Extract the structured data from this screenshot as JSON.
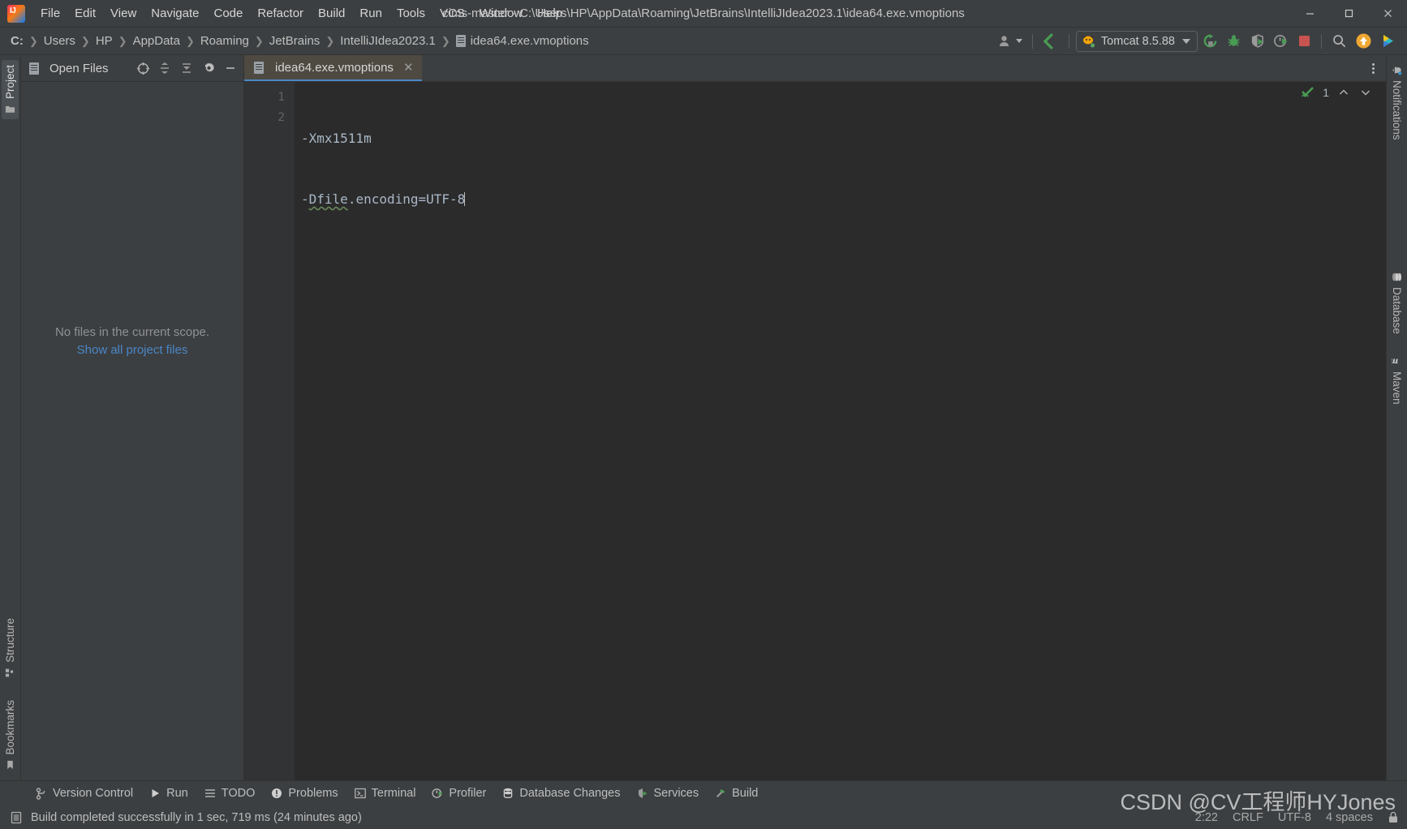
{
  "window": {
    "title": "cims-master - C:\\Users\\HP\\AppData\\Roaming\\JetBrains\\IntelliJIdea2023.1\\idea64.exe.vmoptions",
    "minimize_label": "—",
    "maximize_label": "☐",
    "close_label": "✕"
  },
  "menu": [
    {
      "label": "File"
    },
    {
      "label": "Edit"
    },
    {
      "label": "View"
    },
    {
      "label": "Navigate"
    },
    {
      "label": "Code"
    },
    {
      "label": "Refactor"
    },
    {
      "label": "Build"
    },
    {
      "label": "Run"
    },
    {
      "label": "Tools"
    },
    {
      "label": "VCS"
    },
    {
      "label": "Window"
    },
    {
      "label": "Help"
    }
  ],
  "breadcrumbs": [
    {
      "label": "C:"
    },
    {
      "label": "Users"
    },
    {
      "label": "HP"
    },
    {
      "label": "AppData"
    },
    {
      "label": "Roaming"
    },
    {
      "label": "JetBrains"
    },
    {
      "label": "IntelliJIdea2023.1"
    },
    {
      "label": "idea64.exe.vmoptions"
    }
  ],
  "toolbar": {
    "account_icon": "user-account-icon",
    "updates_icon": "green-arrow-icon",
    "run_config": "Tomcat 8.5.88",
    "run_icon": "run-icon",
    "debug_icon": "debug-bug-icon",
    "coverage_icon": "run-with-coverage-icon",
    "profiler_icon": "profiler-icon",
    "stop_icon": "stop-icon",
    "search_icon": "search-icon",
    "update_badge_icon": "update-available-icon",
    "ide_feature_icon": "ide-feature-icon"
  },
  "left_stripe": {
    "top": [
      {
        "label": "Project",
        "icon": "project-folder-icon"
      }
    ],
    "bottom": [
      {
        "label": "Structure",
        "icon": "structure-icon"
      },
      {
        "label": "Bookmarks",
        "icon": "bookmark-icon"
      }
    ]
  },
  "right_stripe": [
    {
      "label": "Notifications",
      "icon": "bell-icon"
    },
    {
      "label": "Database",
      "icon": "database-icon"
    },
    {
      "label": "Maven",
      "icon": "maven-m-icon"
    }
  ],
  "project_panel": {
    "title": "Open Files",
    "icon": "file-icon",
    "actions": [
      {
        "name": "scope-target-icon",
        "glyph": "⊕"
      },
      {
        "name": "expand-all-icon",
        "glyph": "⇕"
      },
      {
        "name": "collapse-all-icon",
        "glyph": "⇡"
      },
      {
        "name": "settings-gear-icon",
        "glyph": "⚙"
      },
      {
        "name": "hide-panel-icon",
        "glyph": "—"
      }
    ],
    "empty_message": "No files in the current scope.",
    "empty_link": "Show all project files"
  },
  "editor": {
    "tab_label": "idea64.exe.vmoptions",
    "tab_close": "✕",
    "lines": [
      {
        "number": "1",
        "text": "-Xmx1511m"
      },
      {
        "number": "2",
        "prefix": "-",
        "squiggle": "Dfile",
        "suffix": ".encoding=UTF-8"
      }
    ],
    "inspection_count": "1",
    "inspection_icon": "inspections-ok-icon",
    "prev_problem_icon": "chevron-up-icon",
    "next_problem_icon": "chevron-down-icon"
  },
  "bottom_tools": [
    {
      "label": "Version Control",
      "icon": "version-control-icon"
    },
    {
      "label": "Run",
      "icon": "run-triangle-icon"
    },
    {
      "label": "TODO",
      "icon": "todo-list-icon"
    },
    {
      "label": "Problems",
      "icon": "problems-icon"
    },
    {
      "label": "Terminal",
      "icon": "terminal-icon"
    },
    {
      "label": "Profiler",
      "icon": "profiler-icon"
    },
    {
      "label": "Database Changes",
      "icon": "database-changes-icon"
    },
    {
      "label": "Services",
      "icon": "services-icon"
    },
    {
      "label": "Build",
      "icon": "build-hammer-icon"
    }
  ],
  "statusbar": {
    "message_icon": "event-log-icon",
    "message": "Build completed successfully in 1 sec, 719 ms (24 minutes ago)",
    "position": "2:22",
    "line_separator": "CRLF",
    "encoding": "UTF-8",
    "indent": "4 spaces",
    "lock_icon": "readonly-toggle-icon"
  },
  "watermark": "CSDN @CV工程师HYJones",
  "colors": {
    "chrome": "#3c3f41",
    "editor_bg": "#2b2b2b",
    "gutter_bg": "#313335",
    "accent_blue": "#4a88c7",
    "code_fg": "#a9b7c6",
    "green": "#499c54",
    "link": "#4a86c7",
    "tab_active": "#4e4a42"
  }
}
